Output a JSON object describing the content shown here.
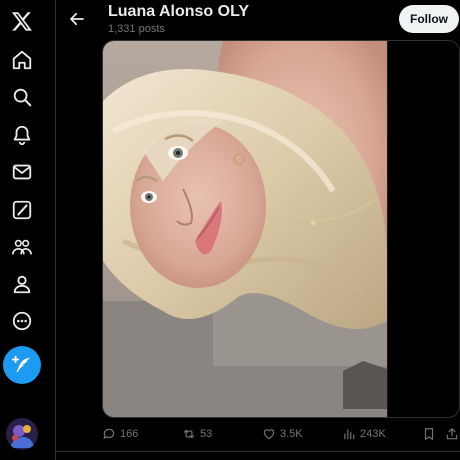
{
  "header": {
    "profile_name": "Luana Alonso OLY",
    "post_count": "1,331 posts",
    "follow_label": "Follow"
  },
  "sidebar": {
    "items": [
      {
        "name": "x-logo-icon"
      },
      {
        "name": "home-icon"
      },
      {
        "name": "search-icon"
      },
      {
        "name": "notifications-icon"
      },
      {
        "name": "messages-icon"
      },
      {
        "name": "grok-icon"
      },
      {
        "name": "communities-icon"
      },
      {
        "name": "profile-icon"
      },
      {
        "name": "more-icon"
      }
    ],
    "post_button_icon": "feather-plus-icon"
  },
  "post": {
    "replies": "166",
    "reposts": "53",
    "likes": "3.5K",
    "views": "243K"
  },
  "colors": {
    "accent": "#1d9bf0",
    "background": "#000000",
    "text_primary": "#e7e9ea",
    "text_secondary": "#71767b",
    "border": "#2f3336"
  }
}
